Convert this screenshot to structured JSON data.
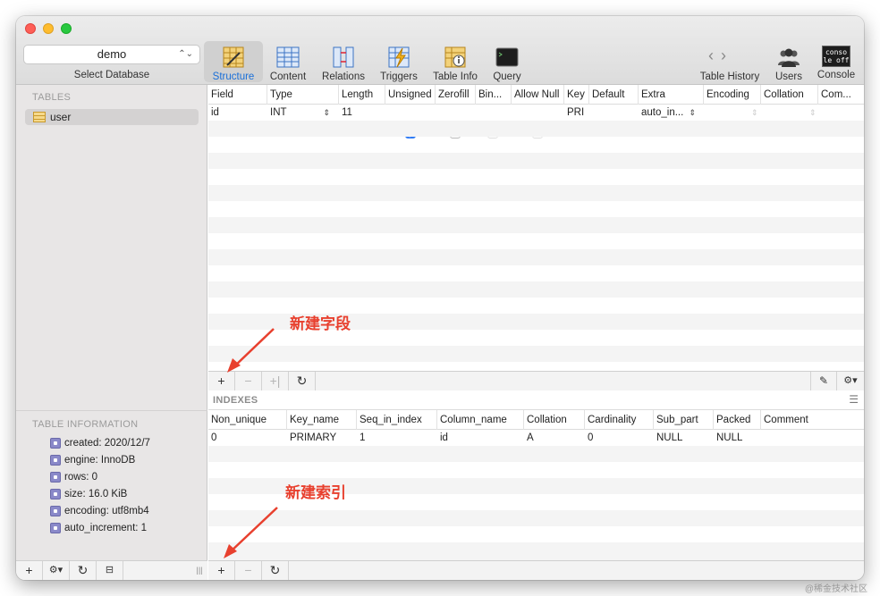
{
  "database": {
    "selected": "demo",
    "label": "Select Database"
  },
  "toolbar": {
    "structure": "Structure",
    "content": "Content",
    "relations": "Relations",
    "triggers": "Triggers",
    "table_info": "Table Info",
    "query": "Query",
    "history": "Table History",
    "users": "Users",
    "console": "Console",
    "console_icon_text": "conso le off"
  },
  "sidebar": {
    "tables_heading": "TABLES",
    "tables": [
      "user"
    ],
    "info_heading": "TABLE INFORMATION",
    "info": [
      "created: 2020/12/7",
      "engine: InnoDB",
      "rows: 0",
      "size: 16.0 KiB",
      "encoding: utf8mb4",
      "auto_increment: 1"
    ]
  },
  "structure": {
    "columns": [
      "Field",
      "Type",
      "Length",
      "Unsigned",
      "Zerofill",
      "Bin...",
      "Allow Null",
      "Key",
      "Default",
      "Extra",
      "Encoding",
      "Collation",
      "Com..."
    ],
    "rows": [
      {
        "field": "id",
        "type": "INT",
        "length": "11",
        "unsigned": true,
        "zerofill": false,
        "binary": false,
        "allow_null": false,
        "key": "PRI",
        "default": "",
        "extra": "auto_in..."
      }
    ]
  },
  "indexes": {
    "heading": "INDEXES",
    "columns": [
      "Non_unique",
      "Key_name",
      "Seq_in_index",
      "Column_name",
      "Collation",
      "Cardinality",
      "Sub_part",
      "Packed",
      "Comment"
    ],
    "rows": [
      [
        "0",
        "PRIMARY",
        "1",
        "id",
        "A",
        "0",
        "NULL",
        "NULL",
        ""
      ]
    ]
  },
  "annotations": {
    "new_field": "新建字段",
    "new_index": "新建索引"
  },
  "watermark": "@稀金技术社区",
  "colors": {
    "accent": "#1a6fd8",
    "annotation": "#e8402e"
  }
}
